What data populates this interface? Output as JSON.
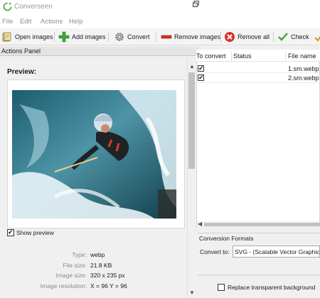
{
  "window": {
    "title": "Converseen"
  },
  "menu": [
    "File",
    "Edit",
    "Actions",
    "Help"
  ],
  "toolbar": {
    "open_images": "Open images",
    "add_images": "Add images",
    "convert": "Convert",
    "remove_images": "Remove images",
    "remove_all": "Remove all",
    "check": "Check"
  },
  "panel": {
    "title": "Actions Panel",
    "preview_label": "Preview:",
    "show_preview_label": "Show preview",
    "show_preview_checked": true,
    "info": [
      {
        "label": "Type:",
        "value": "webp"
      },
      {
        "label": "File size:",
        "value": "21.8 KB"
      },
      {
        "label": "Image size:",
        "value": "320 x 235 px"
      },
      {
        "label": "Image resolution:",
        "value": "X = 96 Y = 96"
      }
    ]
  },
  "list": {
    "columns": [
      "To convert",
      "Status",
      "File name"
    ],
    "rows": [
      {
        "checked": true,
        "status": "",
        "file_name": "1.sm.webp"
      },
      {
        "checked": true,
        "status": "",
        "file_name": "2.sm.webp"
      }
    ]
  },
  "conversion": {
    "title": "Conversion Formats",
    "convert_to_label": "Convert to:",
    "selected_format": "SVG - (Scalable Vector Graphics)",
    "replace_transparent_label": "Replace transparent background",
    "replace_transparent_checked": false
  },
  "colors": {
    "green_icon": "#3fa535",
    "red_icon": "#d9302a",
    "scroll_thumb": "#c1c1c1"
  }
}
